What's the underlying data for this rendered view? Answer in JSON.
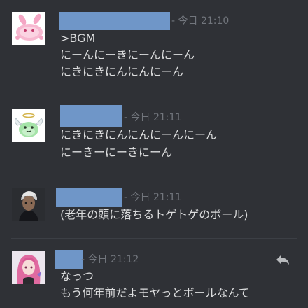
{
  "messages": [
    {
      "timestamp": "- 今日 21:10",
      "lines": [
        ">BGM",
        "にーんにーきにーんにーん",
        "にきにきにんにんにーん"
      ]
    },
    {
      "timestamp": "- 今日 21:11",
      "lines": [
        "にきにきにんにんにーんにーん",
        "にーきーにーきにーん"
      ]
    },
    {
      "timestamp": "- 今日 21:11",
      "lines": [
        "(老年の頭に落ちるトゲトゲのボール)"
      ]
    },
    {
      "timestamp": "- 今日 21:12",
      "lines": [
        "なっつ",
        "もう何年前だよモヤっとボールなんて"
      ]
    }
  ],
  "icons": {
    "reply": "reply-icon"
  },
  "colors": {
    "background": "#2f3136",
    "name_redaction": "#6f96c8",
    "text": "#dcddde",
    "timestamp": "#72767d"
  }
}
